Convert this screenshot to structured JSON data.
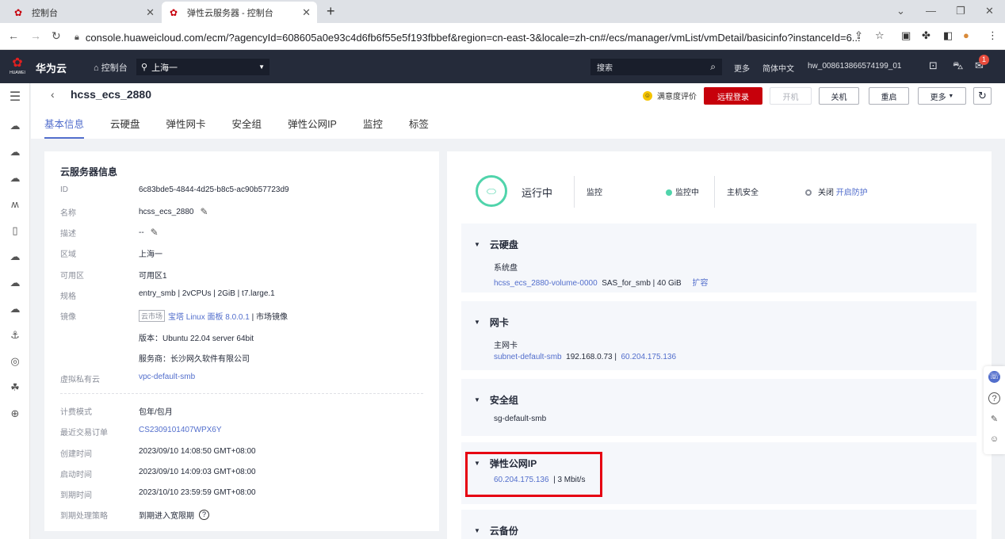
{
  "browser": {
    "tabs": [
      {
        "title": "控制台"
      },
      {
        "title": "弹性云服务器 - 控制台"
      }
    ],
    "url": "console.huaweicloud.com/ecm/?agencyId=608605a0e93c4d6fb6f55e5f193fbbef&region=cn-east-3&locale=zh-cn#/ecs/manager/vmList/vmDetail/basicinfo?instanceId=6..."
  },
  "header": {
    "logo_text": "HUAWEI",
    "brand": "华为云",
    "console": "控制台",
    "region": "上海一",
    "search_placeholder": "搜索",
    "more": "更多",
    "language": "简体中文",
    "username": "hw_008613866574199_01",
    "notification_count": "1"
  },
  "page": {
    "title": "hcss_ecs_2880",
    "tabs": [
      "基本信息",
      "云硬盘",
      "弹性网卡",
      "安全组",
      "弹性公网IP",
      "监控",
      "标签"
    ],
    "rating": "满意度评价",
    "buttons": {
      "remote_login": "远程登录",
      "start": "开机",
      "shutdown": "关机",
      "restart": "重启",
      "more": "更多"
    }
  },
  "server_info": {
    "title": "云服务器信息",
    "rows": [
      {
        "k": "ID",
        "v": "6c83bde5-4844-4d25-b8c5-ac90b57723d9"
      },
      {
        "k": "名称",
        "v": "hcss_ecs_2880"
      },
      {
        "k": "描述",
        "v": "--"
      },
      {
        "k": "区域",
        "v": "上海一"
      },
      {
        "k": "可用区",
        "v": "可用区1"
      },
      {
        "k": "规格",
        "v": "entry_smb | 2vCPUs | 2GiB | t7.large.1"
      },
      {
        "k": "镜像",
        "tag": "云市场",
        "link": "宝塔 Linux 面板 8.0.0.1",
        "suffix": "| 市场镜像"
      },
      {
        "k": "",
        "v": "版本：Ubuntu 22.04 server 64bit"
      },
      {
        "k": "",
        "v": "服务商：长沙网久软件有限公司"
      },
      {
        "k": "虚拟私有云",
        "v": "vpc-default-smb"
      }
    ],
    "billing_rows": [
      {
        "k": "计费模式",
        "v": "包年/包月"
      },
      {
        "k": "最近交易订单",
        "v": "CS2309101407WPX6Y"
      },
      {
        "k": "创建时间",
        "v": "2023/09/10 14:08:50 GMT+08:00"
      },
      {
        "k": "启动时间",
        "v": "2023/09/10 14:09:03 GMT+08:00"
      },
      {
        "k": "到期时间",
        "v": "2023/10/10 23:59:59 GMT+08:00"
      },
      {
        "k": "到期处理策略",
        "v": "到期进入宽限期"
      }
    ]
  },
  "status": {
    "state": "运行中",
    "monitor_label": "监控",
    "monitor_state": "监控中",
    "host_security_label": "主机安全",
    "host_security_state": "关闭",
    "host_security_action": "开启防护"
  },
  "sections": {
    "disk": {
      "title": "云硬盘",
      "sub_label": "系统盘",
      "volume": "hcss_ecs_2880-volume-0000",
      "detail": "SAS_for_smb | 40 GiB",
      "action": "扩容"
    },
    "nic": {
      "title": "网卡",
      "sub_label": "主网卡",
      "subnet": "subnet-default-smb",
      "private_ip": "192.168.0.73 |",
      "public_ip": "60.204.175.136"
    },
    "secgroup": {
      "title": "安全组",
      "name": "sg-default-smb"
    },
    "eip": {
      "title": "弹性公网IP",
      "ip": "60.204.175.136",
      "bandwidth": "| 3 Mbit/s"
    },
    "backup": {
      "title": "云备份"
    }
  },
  "colors": {
    "brand_red": "#c7000b",
    "link_blue": "#526ecc",
    "status_green": "#50d4ab",
    "highlight_red": "#e60012"
  }
}
